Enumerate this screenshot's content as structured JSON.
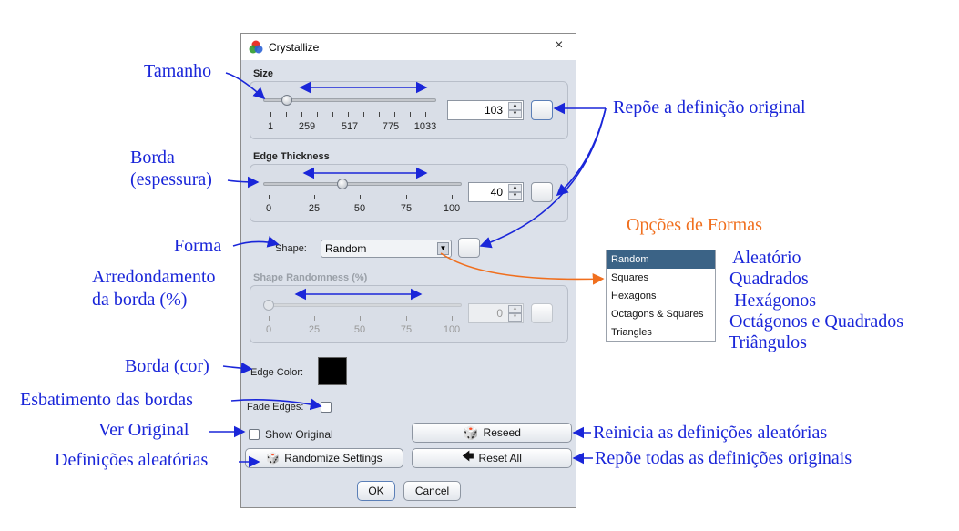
{
  "dialog": {
    "title": "Crystallize",
    "close": "×",
    "size": {
      "label": "Size",
      "value": "103",
      "ticks": [
        "1",
        "259",
        "517",
        "775",
        "1033"
      ],
      "position": 0.1
    },
    "edge_thickness": {
      "label": "Edge Thickness",
      "value": "40",
      "ticks": [
        "0",
        "25",
        "50",
        "75",
        "100"
      ],
      "position": 0.4
    },
    "shape": {
      "label": "Shape:",
      "selected": "Random",
      "arrow": "▼"
    },
    "shape_randomness": {
      "label": "Shape Randomness (%)",
      "value": "0",
      "ticks": [
        "0",
        "25",
        "50",
        "75",
        "100"
      ],
      "position": 0.0
    },
    "edge_color": {
      "label": "Edge Color:",
      "color": "#000000"
    },
    "fade_edges": {
      "label": "Fade Edges:",
      "checked": false
    },
    "show_original": {
      "label": "Show Original",
      "checked": false
    },
    "reseed_label": "Reseed",
    "randomize_label": "Randomize Settings",
    "reset_all_label": "Reset All",
    "ok_label": "OK",
    "cancel_label": "Cancel",
    "reset_arrow": "🡄"
  },
  "shape_options": {
    "heading": "Opções de Formas",
    "items": [
      "Random",
      "Squares",
      "Hexagons",
      "Octagons & Squares",
      "Triangles"
    ],
    "selected_index": 0,
    "translations": [
      "Aleatório",
      "Quadrados",
      "Hexágonos",
      "Octágonos e Quadrados",
      "Triângulos"
    ]
  },
  "annotations": {
    "tamanho": "Tamanho",
    "borda_line1": "Borda",
    "borda_line2": "(espessura)",
    "forma": "Forma",
    "arred_line1": "Arredondamento",
    "arred_line2": "da borda (%)",
    "borda_cor": "Borda (cor)",
    "esbatimento": "Esbatimento das bordas",
    "ver_original": "Ver Original",
    "def_aleatorias": "Definições aleatórias",
    "repoe_original": "Repõe a definição original",
    "reinicia": "Reinicia as definições aleatórias",
    "repoe_todas": "Repõe todas as definições originais"
  },
  "colors": {
    "annotation_blue": "#1a26d9",
    "annotation_orange": "#f06f1e",
    "dialog_bg": "#dce1ea",
    "list_selected_bg": "#3b6386"
  }
}
